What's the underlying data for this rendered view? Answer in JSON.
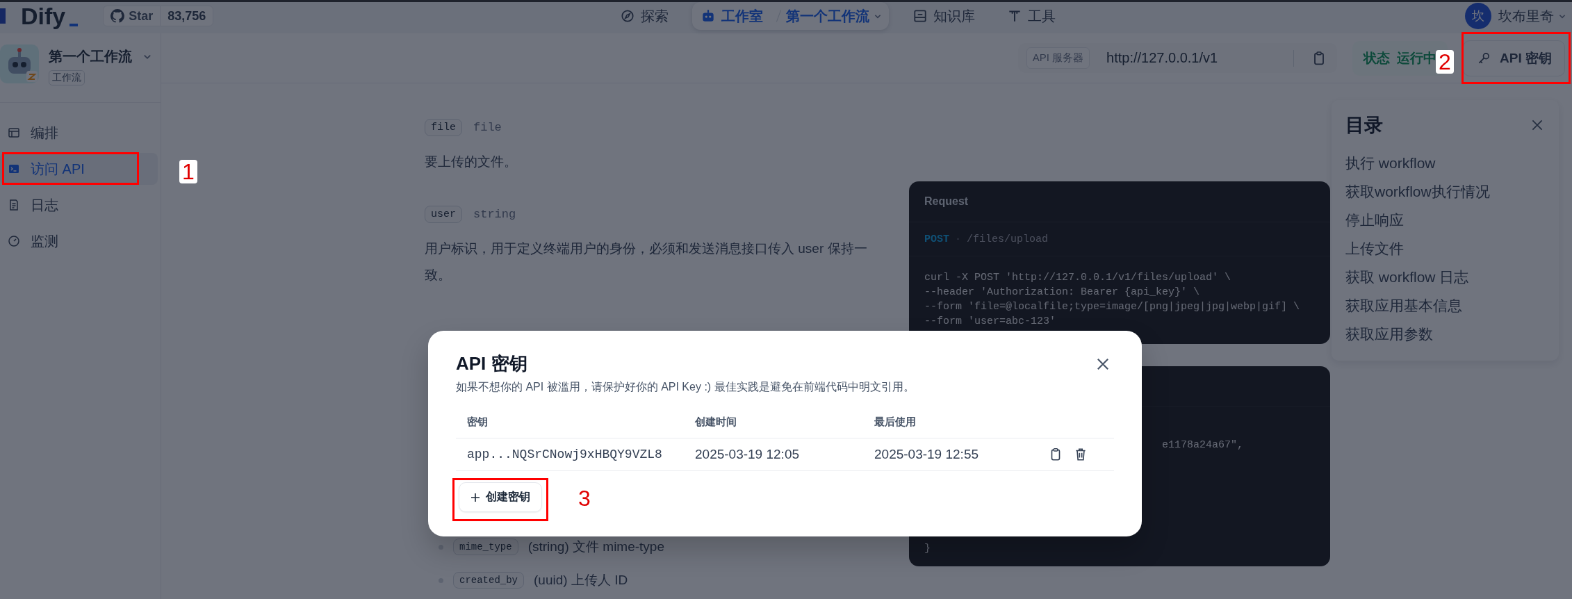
{
  "top_bar": {
    "logo": "Dify",
    "github": {
      "label": "Star",
      "count": "83,756"
    },
    "nav": [
      {
        "label": "探索",
        "selected": false
      },
      {
        "label": "工作室",
        "selected": true,
        "crumb": "第一个工作流"
      },
      {
        "label": "知识库",
        "selected": false
      },
      {
        "label": "工具",
        "selected": false
      }
    ],
    "user": {
      "avatar": "坎",
      "name": "坎布里奇"
    }
  },
  "sidebar": {
    "app": {
      "name": "第一个工作流",
      "type": "工作流"
    },
    "items": [
      {
        "label": "编排",
        "selected": false
      },
      {
        "label": "访问 API",
        "selected": true
      },
      {
        "label": "日志",
        "selected": false
      },
      {
        "label": "监测",
        "selected": false
      }
    ]
  },
  "api_bar": {
    "server_label": "API 服务器",
    "server_url": "http://127.0.0.1/v1",
    "status_label": "状态",
    "status_value": "运行中",
    "key_button": "API 密钥"
  },
  "doc": {
    "params": [
      {
        "name": "file",
        "type": "file",
        "description": "要上传的文件。"
      },
      {
        "name": "user",
        "type": "string",
        "description": "用户标识，用于定义终端用户的身份，必须和发送消息接口传入 user 保持一致。"
      }
    ],
    "fields": [
      {
        "name": "mime_type",
        "description": "(string) 文件 mime-type"
      },
      {
        "name": "created_by",
        "description": "(uuid) 上传人 ID"
      }
    ]
  },
  "request": {
    "title": "Request",
    "method": "POST",
    "separator": "·",
    "path": "/files/upload",
    "lines": [
      "curl -X POST 'http://127.0.0.1/v1/files/upload' \\",
      "--header 'Authorization: Bearer {api_key}' \\",
      "--form 'file=@localfile;type=image/[png|jpeg|jpg|webp|gif] \\",
      "--form 'user=abc-123'"
    ]
  },
  "response_fragment": {
    "lines": [
      "e1178a24a67\",",
      "}"
    ]
  },
  "toc": {
    "title": "目录",
    "items": [
      "执行 workflow",
      "获取workflow执行情况",
      "停止响应",
      "上传文件",
      "获取 workflow 日志",
      "获取应用基本信息",
      "获取应用参数"
    ]
  },
  "modal": {
    "title": "API 密钥",
    "description": "如果不想你的 API 被滥用，请保护好你的 API Key :) 最佳实践是避免在前端代码中明文引用。",
    "columns": [
      "密钥",
      "创建时间",
      "最后使用"
    ],
    "rows": [
      {
        "key": "app...NQSrCNowj9xHBQY9VZL8",
        "created": "2025-03-19 12:05",
        "last_used": "2025-03-19 12:55"
      }
    ],
    "create_button": "创建密钥"
  },
  "annotations": [
    {
      "label": "1"
    },
    {
      "label": "2"
    },
    {
      "label": "3"
    }
  ]
}
